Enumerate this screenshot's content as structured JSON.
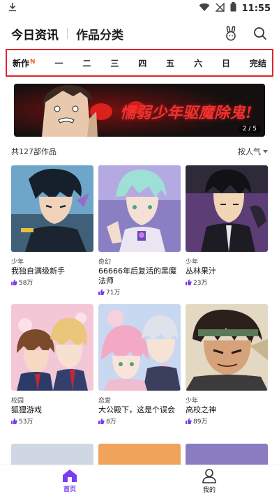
{
  "status_bar": {
    "time": "11:55"
  },
  "header": {
    "tab_active": "今日资讯",
    "tab_inactive": "作品分类"
  },
  "day_tabs": [
    {
      "label": "新作",
      "badge": "N"
    },
    {
      "label": "一"
    },
    {
      "label": "二"
    },
    {
      "label": "三"
    },
    {
      "label": "四"
    },
    {
      "label": "五"
    },
    {
      "label": "六"
    },
    {
      "label": "日"
    },
    {
      "label": "完结"
    }
  ],
  "banner": {
    "title": "懦弱少年驱魔除鬼!",
    "page_indicator": "2 / 5"
  },
  "list": {
    "count_text": "共127部作品",
    "sort_label": "按人气"
  },
  "cards": [
    {
      "genre": "少年",
      "title": "我独自满级新手",
      "likes": "58万"
    },
    {
      "genre": "奇幻",
      "title": "66666年后复活的黑魔法师",
      "likes": "71万"
    },
    {
      "genre": "少年",
      "title": "丛林果汁",
      "likes": "23万"
    },
    {
      "genre": "校园",
      "title": "狐狸游戏",
      "likes": "53万"
    },
    {
      "genre": "恋爱",
      "title": "大公殿下，这是个误会",
      "likes": "8万"
    },
    {
      "genre": "少年",
      "title": "高校之神",
      "likes": "89万"
    }
  ],
  "bottom_nav": [
    {
      "label": "首页",
      "active": true
    },
    {
      "label": "我的",
      "active": false
    }
  ],
  "colors": {
    "accent": "#7a3cf0",
    "highlight_border": "#e0242c",
    "new_badge": "#ff5a1f",
    "banner_text": "#f0312f"
  }
}
